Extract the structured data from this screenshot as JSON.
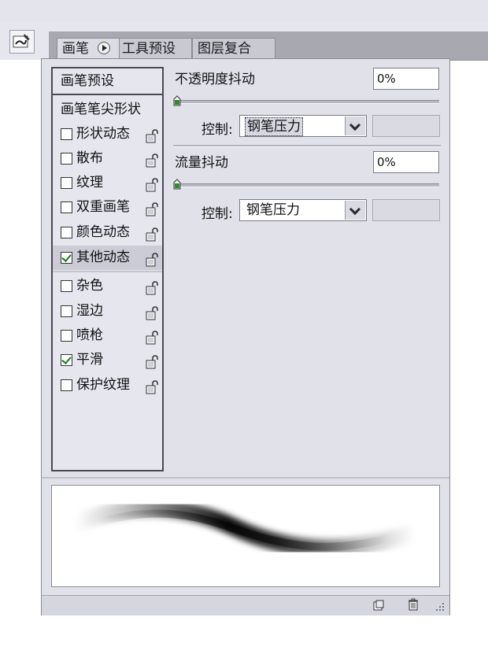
{
  "tabs": [
    {
      "label": "画笔"
    },
    {
      "label": "工具预设"
    },
    {
      "label": "图层复合"
    }
  ],
  "left_panel": {
    "presets_label": "画笔预设",
    "tip_shape_label": "画笔笔尖形状",
    "options": [
      {
        "label": "形状动态",
        "checked": false
      },
      {
        "label": "散布",
        "checked": false
      },
      {
        "label": "纹理",
        "checked": false
      },
      {
        "label": "双重画笔",
        "checked": false
      },
      {
        "label": "颜色动态",
        "checked": false
      },
      {
        "label": "其他动态",
        "checked": true,
        "selected": true
      },
      {
        "label": "杂色",
        "checked": false
      },
      {
        "label": "湿边",
        "checked": false
      },
      {
        "label": "喷枪",
        "checked": false
      },
      {
        "label": "平滑",
        "checked": true
      },
      {
        "label": "保护纹理",
        "checked": false
      }
    ]
  },
  "opacity_jitter": {
    "label": "不透明度抖动",
    "value": "0%",
    "slider_level": 0,
    "control_label": "控制:",
    "control_value": "钢笔压力"
  },
  "flow_jitter": {
    "label": "流量抖动",
    "value": "0%",
    "slider_level": 0,
    "control_label": "控制:",
    "control_value": "钢笔压力"
  },
  "icons": {
    "palette": "brush-palette-icon",
    "tab_menu": "play-circle-icon",
    "lock": "lock-icon",
    "new": "new-brush-icon",
    "trash": "trash-icon",
    "grip": "resize-grip-icon"
  },
  "colors": {
    "panel_bg": "#e1e1e9",
    "check_mark": "#1a7a1a",
    "selected_row": "#ccccd6"
  }
}
